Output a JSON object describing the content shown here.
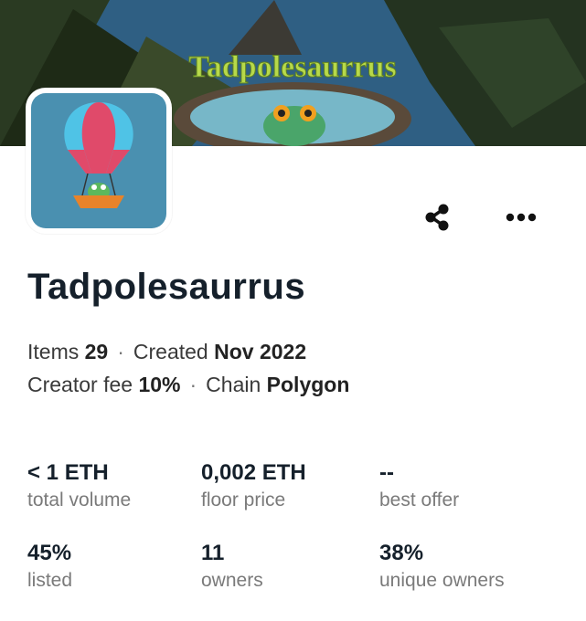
{
  "banner": {
    "text": "Tadpolesaurrus"
  },
  "collection": {
    "name": "Tadpolesaurrus",
    "items_label": "Items",
    "items_value": "29",
    "created_label": "Created",
    "created_value": "Nov 2022",
    "fee_label": "Creator fee",
    "fee_value": "10%",
    "chain_label": "Chain",
    "chain_value": "Polygon",
    "separator": "·"
  },
  "actions": {
    "share_icon": "share-icon",
    "more_icon": "more-horizontal-icon"
  },
  "stats": [
    {
      "value": "< 1 ETH",
      "label": "total volume"
    },
    {
      "value": "0,002 ETH",
      "label": "floor price"
    },
    {
      "value": "--",
      "label": "best offer"
    },
    {
      "value": "45%",
      "label": "listed"
    },
    {
      "value": "11",
      "label": "owners"
    },
    {
      "value": "38%",
      "label": "unique owners"
    }
  ],
  "colors": {
    "title": "#15202b",
    "label": "#7a7a7a",
    "avatar_bg": "#4a90b0",
    "banner_sky": "#2f5f83"
  }
}
